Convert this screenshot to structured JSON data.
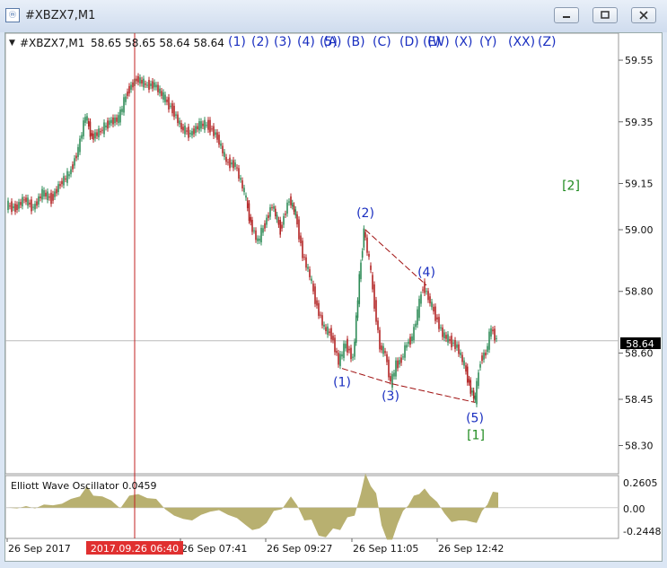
{
  "window": {
    "title": "#XBZX7,M1",
    "icon": "chart-window-icon",
    "controls": [
      "minimize-icon",
      "restore-icon",
      "close-icon"
    ]
  },
  "chart_header": {
    "symbol_label": "#XBZX7,M1",
    "ohlc": "58.65 58.65 58.64 58.64",
    "wave_labels": [
      "(1)",
      "(2)",
      "(3)",
      "(4)",
      "(5)",
      "(A)",
      "(B)",
      "(C)",
      "(D)",
      "(E)",
      "(W)",
      "(X)",
      "(Y)",
      "(XX)",
      "(Z)"
    ]
  },
  "current_price": "58.64",
  "oscillator": {
    "label": "Elliott Wave Oscillator 0.0459",
    "ticks": [
      "0.2605",
      "0.00",
      "-0.2448"
    ]
  },
  "chart_data": {
    "type": "bar",
    "title": "#XBZX7,M1",
    "x_tick_labels": [
      "26 Sep 2017",
      "26 Sep 07:41",
      "26 Sep 09:27",
      "26 Sep 11:05",
      "26 Sep 12:42"
    ],
    "crosshair_time": "2017.09.26 06:40",
    "y_tick_labels": [
      "59.55",
      "59.35",
      "59.15",
      "59.00",
      "58.80",
      "58.60",
      "58.45",
      "58.30"
    ],
    "ylim": [
      58.22,
      59.62
    ],
    "close_series": [
      {
        "x": 0,
        "y": 59.08
      },
      {
        "x": 10,
        "y": 59.07
      },
      {
        "x": 20,
        "y": 59.1
      },
      {
        "x": 30,
        "y": 59.07
      },
      {
        "x": 40,
        "y": 59.12
      },
      {
        "x": 50,
        "y": 59.1
      },
      {
        "x": 60,
        "y": 59.15
      },
      {
        "x": 70,
        "y": 59.18
      },
      {
        "x": 80,
        "y": 59.26
      },
      {
        "x": 88,
        "y": 59.37
      },
      {
        "x": 95,
        "y": 59.3
      },
      {
        "x": 105,
        "y": 59.32
      },
      {
        "x": 115,
        "y": 59.35
      },
      {
        "x": 125,
        "y": 59.36
      },
      {
        "x": 135,
        "y": 59.45
      },
      {
        "x": 145,
        "y": 59.49
      },
      {
        "x": 155,
        "y": 59.47
      },
      {
        "x": 165,
        "y": 59.47
      },
      {
        "x": 175,
        "y": 59.43
      },
      {
        "x": 185,
        "y": 59.39
      },
      {
        "x": 195,
        "y": 59.33
      },
      {
        "x": 205,
        "y": 59.31
      },
      {
        "x": 215,
        "y": 59.34
      },
      {
        "x": 225,
        "y": 59.34
      },
      {
        "x": 235,
        "y": 59.3
      },
      {
        "x": 245,
        "y": 59.22
      },
      {
        "x": 255,
        "y": 59.21
      },
      {
        "x": 265,
        "y": 59.12
      },
      {
        "x": 272,
        "y": 59.02
      },
      {
        "x": 280,
        "y": 58.96
      },
      {
        "x": 288,
        "y": 59.02
      },
      {
        "x": 296,
        "y": 59.08
      },
      {
        "x": 305,
        "y": 59.0
      },
      {
        "x": 315,
        "y": 59.1
      },
      {
        "x": 322,
        "y": 59.05
      },
      {
        "x": 330,
        "y": 58.92
      },
      {
        "x": 338,
        "y": 58.85
      },
      {
        "x": 346,
        "y": 58.75
      },
      {
        "x": 354,
        "y": 58.68
      },
      {
        "x": 362,
        "y": 58.66
      },
      {
        "x": 370,
        "y": 58.57
      },
      {
        "x": 378,
        "y": 58.63
      },
      {
        "x": 386,
        "y": 58.58
      },
      {
        "x": 393,
        "y": 58.84
      },
      {
        "x": 398,
        "y": 59.0
      },
      {
        "x": 404,
        "y": 58.9
      },
      {
        "x": 410,
        "y": 58.76
      },
      {
        "x": 416,
        "y": 58.62
      },
      {
        "x": 422,
        "y": 58.6
      },
      {
        "x": 428,
        "y": 58.5
      },
      {
        "x": 434,
        "y": 58.56
      },
      {
        "x": 440,
        "y": 58.58
      },
      {
        "x": 446,
        "y": 58.63
      },
      {
        "x": 452,
        "y": 58.65
      },
      {
        "x": 458,
        "y": 58.73
      },
      {
        "x": 464,
        "y": 58.82
      },
      {
        "x": 470,
        "y": 58.78
      },
      {
        "x": 478,
        "y": 58.72
      },
      {
        "x": 486,
        "y": 58.66
      },
      {
        "x": 494,
        "y": 58.64
      },
      {
        "x": 502,
        "y": 58.62
      },
      {
        "x": 510,
        "y": 58.56
      },
      {
        "x": 517,
        "y": 58.48
      },
      {
        "x": 522,
        "y": 58.45
      },
      {
        "x": 528,
        "y": 58.58
      },
      {
        "x": 534,
        "y": 58.6
      },
      {
        "x": 540,
        "y": 58.68
      },
      {
        "x": 546,
        "y": 58.64
      }
    ],
    "wave_points": [
      {
        "label": "(1)",
        "x": 372,
        "y": 58.55
      },
      {
        "label": "(2)",
        "x": 398,
        "y": 59.0
      },
      {
        "label": "(3)",
        "x": 428,
        "y": 58.5
      },
      {
        "label": "(4)",
        "x": 466,
        "y": 58.82
      },
      {
        "label": "(5)",
        "x": 520,
        "y": 58.44
      }
    ],
    "degree_labels": [
      {
        "label": "[1]",
        "x": 524,
        "y": 58.32
      },
      {
        "label": "[2]",
        "x": 630,
        "y": 59.13
      }
    ]
  },
  "colors": {
    "bull": "#2e8b57",
    "bear": "#b22222",
    "wave_label": "#1a2fc0",
    "degree_label": "#1f8a1f",
    "channel_line": "#a01010",
    "crosshair": "#c02020",
    "oscillator_fill": "#b8b070",
    "crosshair_time_bg": "#e03030"
  }
}
